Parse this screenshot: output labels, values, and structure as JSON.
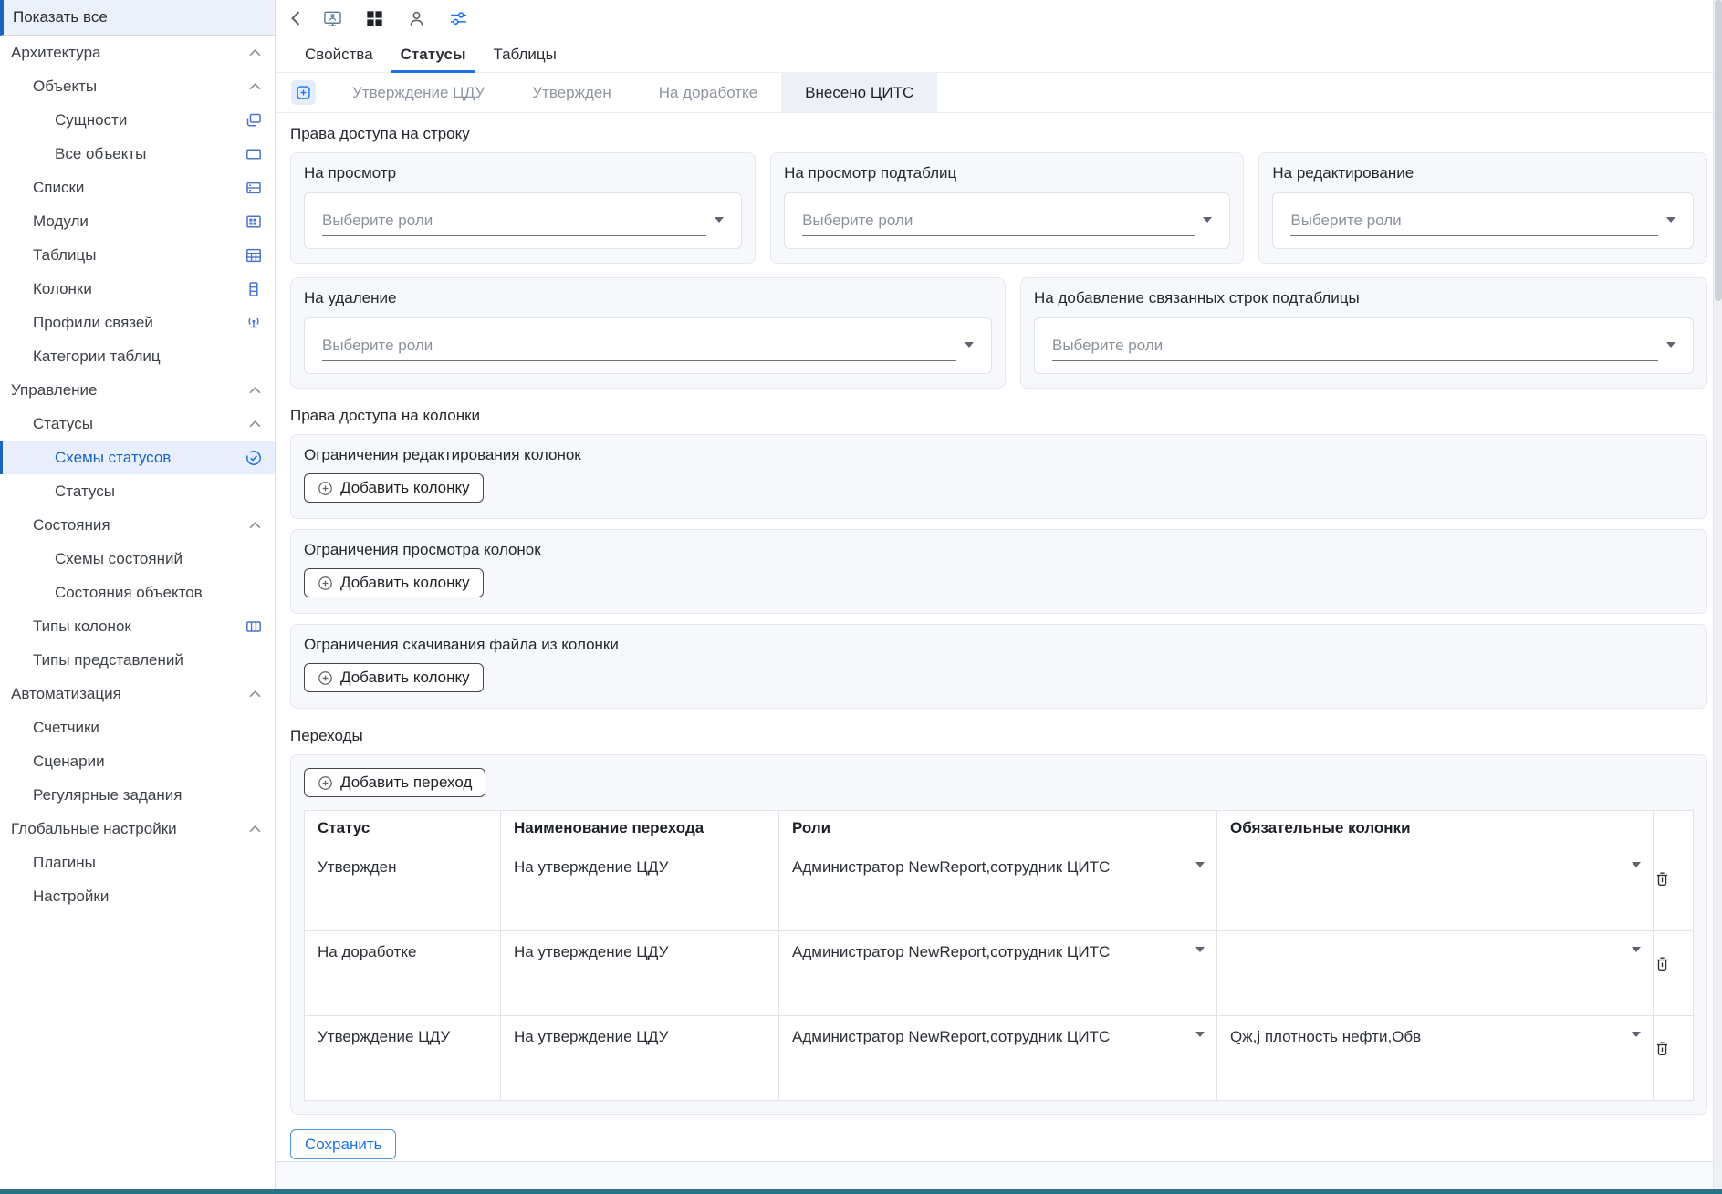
{
  "colors": {
    "accent": "#1a73e8",
    "selected_text": "#1765c1",
    "bottom_bar": "#2e7086"
  },
  "sidebar": {
    "show_all_label": "Показать все",
    "items": [
      {
        "label": "Архитектура",
        "chevron": "chevron-up-icon"
      },
      {
        "label": "Объекты",
        "chevron": "chevron-up-icon"
      },
      {
        "label": "Сущности",
        "icon": "copy-icon"
      },
      {
        "label": "Все объекты",
        "icon": "rectangle-icon"
      },
      {
        "label": "Списки",
        "icon": "storage-icon"
      },
      {
        "label": "Модули",
        "icon": "modules-icon"
      },
      {
        "label": "Таблицы",
        "icon": "table-icon"
      },
      {
        "label": "Колонки",
        "icon": "column-icon"
      },
      {
        "label": "Профили связей",
        "icon": "antenna-icon"
      },
      {
        "label": "Категории таблиц"
      },
      {
        "label": "Управление",
        "chevron": "chevron-up-icon"
      },
      {
        "label": "Статусы",
        "chevron": "chevron-up-icon"
      },
      {
        "label": "Схемы статусов",
        "icon": "schedule-check-icon",
        "selected": true
      },
      {
        "label": "Статусы"
      },
      {
        "label": "Состояния",
        "chevron": "chevron-up-icon"
      },
      {
        "label": "Схемы состояний"
      },
      {
        "label": "Состояния объектов"
      },
      {
        "label": "Типы колонок",
        "icon": "view-week-icon"
      },
      {
        "label": "Типы представлений"
      },
      {
        "label": "Автоматизация",
        "chevron": "chevron-up-icon"
      },
      {
        "label": "Счетчики"
      },
      {
        "label": "Сценарии"
      },
      {
        "label": "Регулярные задания"
      },
      {
        "label": "Глобальные настройки",
        "chevron": "chevron-up-icon"
      },
      {
        "label": "Плагины"
      },
      {
        "label": "Настройки"
      }
    ]
  },
  "toolbar": {
    "icons": [
      "chevron-left-icon",
      "monitor-icon",
      "grid-icon",
      "person-icon",
      "sliders-icon"
    ]
  },
  "tabs": [
    {
      "label": "Свойства",
      "active": false
    },
    {
      "label": "Статусы",
      "active": true
    },
    {
      "label": "Таблицы",
      "active": false
    }
  ],
  "status_tabs": [
    {
      "label": "Утверждение ЦДУ",
      "active": false
    },
    {
      "label": "Утвержден",
      "active": false
    },
    {
      "label": "На доработке",
      "active": false
    },
    {
      "label": "Внесено ЦИТС",
      "active": true
    }
  ],
  "row_rights": {
    "title": "Права доступа на строку",
    "select_placeholder": "Выберите роли",
    "cards": [
      {
        "title": "На просмотр"
      },
      {
        "title": "На просмотр подтаблиц"
      },
      {
        "title": "На редактирование"
      },
      {
        "title": "На удаление"
      },
      {
        "title": "На добавление связанных строк подтаблицы"
      }
    ]
  },
  "column_rights": {
    "title": "Права доступа на колонки",
    "add_column_label": "Добавить колонку",
    "cards": [
      {
        "title": "Ограничения редактирования колонок"
      },
      {
        "title": "Ограничения просмотра колонок"
      },
      {
        "title": "Ограничения скачивания файла из колонки"
      }
    ]
  },
  "transitions": {
    "title": "Переходы",
    "add_label": "Добавить переход",
    "headers": [
      "Статус",
      "Наименование перехода",
      "Роли",
      "Обязательные колонки"
    ],
    "rows": [
      {
        "status": "Утвержден",
        "name": "На утверждение ЦДУ",
        "roles": "Администратор NewReport,сотрудник ЦИТС",
        "required": ""
      },
      {
        "status": "На доработке",
        "name": "На утверждение ЦДУ",
        "roles": "Администратор NewReport,сотрудник ЦИТС",
        "required": ""
      },
      {
        "status": "Утверждение ЦДУ",
        "name": "На утверждение ЦДУ",
        "roles": "Администратор NewReport,сотрудник ЦИТС",
        "required": "Qж,j плотность нефти,Обв"
      }
    ]
  },
  "save_label": "Сохранить"
}
